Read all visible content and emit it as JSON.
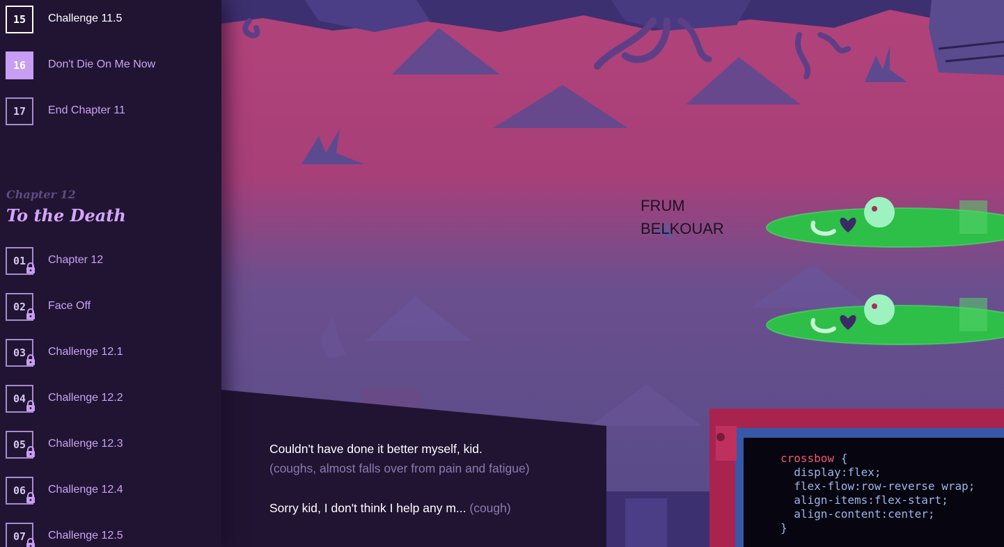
{
  "sidebar": {
    "levels_top": [
      {
        "num": "15",
        "label": "Challenge 11.5",
        "state": "done"
      },
      {
        "num": "16",
        "label": "Don't Die On Me Now",
        "state": "current"
      },
      {
        "num": "17",
        "label": "End Chapter 11",
        "state": "open"
      }
    ],
    "chapter": {
      "kicker": "Chapter 12",
      "title": "To the Death"
    },
    "levels": [
      {
        "num": "01",
        "label": "Chapter 12",
        "locked": true
      },
      {
        "num": "02",
        "label": "Face Off",
        "locked": true
      },
      {
        "num": "03",
        "label": "Challenge 12.1",
        "locked": true
      },
      {
        "num": "04",
        "label": "Challenge 12.2",
        "locked": true
      },
      {
        "num": "05",
        "label": "Challenge 12.3",
        "locked": true
      },
      {
        "num": "06",
        "label": "Challenge 12.4",
        "locked": true
      },
      {
        "num": "07",
        "label": "Challenge 12.5",
        "locked": true
      }
    ],
    "lock_icon": "padlock-icon"
  },
  "board": {
    "name_tag_line1": "FRUM",
    "name_tag_line2": "BELKOUAR"
  },
  "dialogue": {
    "line1": "Couldn't have done it better myself, kid.",
    "line1_action": "(coughs, almost falls over from pain and fatigue)",
    "line2": "Sorry kid, I don't think I help any m...",
    "line2_action": "(cough)"
  },
  "code": {
    "selector": "crossbow",
    "open_brace": "{",
    "lines": [
      "display:flex;",
      "flex-flow:row-reverse wrap;",
      "align-items:flex-start;",
      "align-content:center;"
    ],
    "close_brace": "}"
  },
  "colors": {
    "sidebar_bg": "#211432",
    "accent": "#c79ef3",
    "sky_top": "#b2437a",
    "sky_bottom": "#5a4f8a",
    "slime": "#2dbf48",
    "code_selector": "#f05878",
    "code_text": "#9fb6e8"
  }
}
